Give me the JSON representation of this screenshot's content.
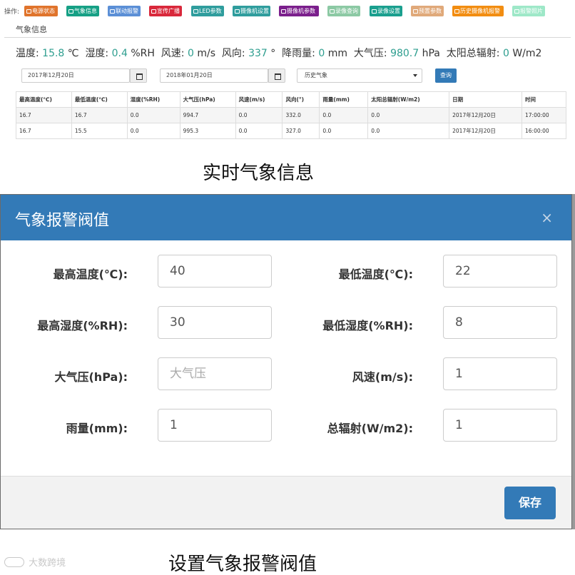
{
  "toolbar": {
    "label": "操作:",
    "buttons": [
      {
        "label": "电源状态",
        "color": "#e0742c"
      },
      {
        "label": "气象信息",
        "color": "#16a085"
      },
      {
        "label": "联动报警",
        "color": "#5b8fd6"
      },
      {
        "label": "宣传广播",
        "color": "#d9283b"
      },
      {
        "label": "LED参数",
        "color": "#2f9d9d"
      },
      {
        "label": "摄像机设置",
        "color": "#2f9d9d"
      },
      {
        "label": "摄像机参数",
        "color": "#7b1f8c"
      },
      {
        "label": "录像查询",
        "color": "#8cc9a4"
      },
      {
        "label": "录像设置",
        "color": "#1a9f8e"
      },
      {
        "label": "预置参数",
        "color": "#e0a97a"
      },
      {
        "label": "历史摄像机报警",
        "color": "#f28d11"
      },
      {
        "label": "报警照片",
        "color": "#9ee8c8"
      }
    ]
  },
  "tab": {
    "label": "气象信息"
  },
  "realtime": {
    "temp_label": "温度:",
    "temp_value": "15.8",
    "temp_unit": "℃",
    "humidity_label": "湿度:",
    "humidity_value": "0.4",
    "humidity_unit": "%RH",
    "wind_speed_label": "风速:",
    "wind_speed_value": "0",
    "wind_speed_unit": "m/s",
    "wind_dir_label": "风向:",
    "wind_dir_value": "337",
    "wind_dir_unit": "°",
    "rain_label": "降雨量:",
    "rain_value": "0",
    "rain_unit": "mm",
    "pressure_label": "大气压:",
    "pressure_value": "980.7",
    "pressure_unit": "hPa",
    "radiation_label": "太阳总辐射:",
    "radiation_value": "0",
    "radiation_unit": "W/m2"
  },
  "filters": {
    "start_date": "2017年12月20日",
    "end_date": "2018年01月20日",
    "type_select": "历史气象",
    "query_label": "查询"
  },
  "table": {
    "headers": [
      "最高温度(℃)",
      "最低温度(℃)",
      "湿度(%RH)",
      "大气压(hPa)",
      "风速(m/s)",
      "风向(°)",
      "雨量(mm)",
      "太阳总辐射(W/m2)",
      "日期",
      "时间"
    ],
    "rows": [
      [
        "16.7",
        "16.7",
        "0.0",
        "994.7",
        "0.0",
        "332.0",
        "0.0",
        "0.0",
        "2017年12月20日",
        "17:00:00"
      ],
      [
        "16.7",
        "15.5",
        "0.0",
        "995.3",
        "0.0",
        "327.0",
        "0.0",
        "0.0",
        "2017年12月20日",
        "16:00:00"
      ]
    ]
  },
  "captions": {
    "top": "实时气象信息",
    "bottom": "设置气象报警阀值"
  },
  "modal": {
    "title": "气象报警阀值",
    "close": "×",
    "fields": {
      "max_temp": {
        "label": "最高温度(℃):",
        "value": "40"
      },
      "min_temp": {
        "label": "最低温度(℃):",
        "value": "22"
      },
      "max_humidity": {
        "label": "最高湿度(%RH):",
        "value": "30"
      },
      "min_humidity": {
        "label": "最低湿度(%RH):",
        "value": "8"
      },
      "pressure": {
        "label": "大气压(hPa):",
        "value": "",
        "placeholder": "大气压"
      },
      "wind_speed": {
        "label": "风速(m/s):",
        "value": "1"
      },
      "rainfall": {
        "label": "雨量(mm):",
        "value": "1"
      },
      "total_radiation": {
        "label": "总辐射(W/m2):",
        "value": "1"
      }
    },
    "save_label": "保存"
  },
  "watermark": {
    "text": "大数跨境"
  },
  "colors": {
    "primary": "#337ab7",
    "value_teal": "#2e9e8f"
  }
}
